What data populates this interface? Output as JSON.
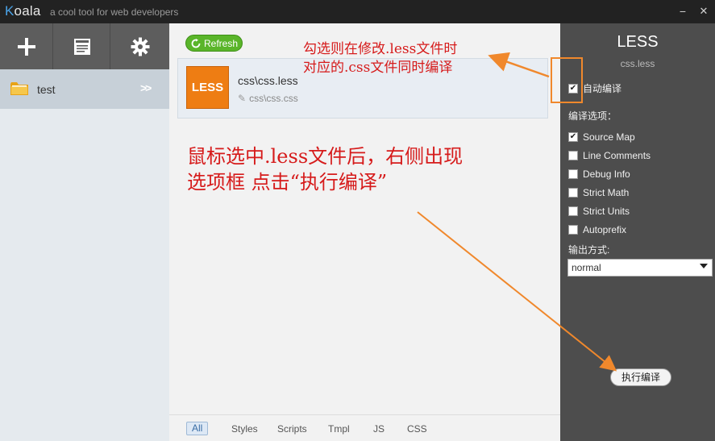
{
  "app": {
    "logo_k": "K",
    "logo_rest": "oala",
    "tagline": "a cool tool for web developers",
    "min_glyph": "−",
    "close_glyph": "✕"
  },
  "sidebar": {
    "tools": [
      {
        "icon": "plus-icon"
      },
      {
        "icon": "document-icon"
      },
      {
        "icon": "gear-icon"
      }
    ],
    "project": {
      "name": "test",
      "chevron": ">>",
      "icon": "folder-icon"
    }
  },
  "main": {
    "refresh_label": "Refresh",
    "file": {
      "badge": "LESS",
      "name": "css\\css.less",
      "output": "css\\css.css"
    },
    "filters": [
      "All",
      "Styles",
      "Scripts",
      "Tmpl",
      "JS",
      "CSS"
    ],
    "active_filter": "All"
  },
  "annotations": {
    "note1_line1": "勾选则在修改.less文件时",
    "note1_line2": "对应的.css文件同时编译",
    "note2_line1": "鼠标选中.less文件后，右侧出现",
    "note2_line2": "选项框 点击“执行编译”",
    "arrow_color": "#f0882c"
  },
  "panel": {
    "title": "LESS",
    "subtitle": "css.less",
    "auto_compile": {
      "label": "自动编译",
      "checked": true
    },
    "options_label": "编译选项：",
    "options": [
      {
        "label": "Source Map",
        "checked": true
      },
      {
        "label": "Line Comments",
        "checked": false
      },
      {
        "label": "Debug Info",
        "checked": false
      },
      {
        "label": "Strict Math",
        "checked": false
      },
      {
        "label": "Strict Units",
        "checked": false
      },
      {
        "label": "Autoprefix",
        "checked": false
      }
    ],
    "output_label": "输出方式:",
    "output_value": "normal",
    "compile_label": "执行编译"
  },
  "colors": {
    "accent_orange": "#ee7d13",
    "refresh_green": "#5ab52a",
    "annotation_red": "#d61b1b"
  }
}
